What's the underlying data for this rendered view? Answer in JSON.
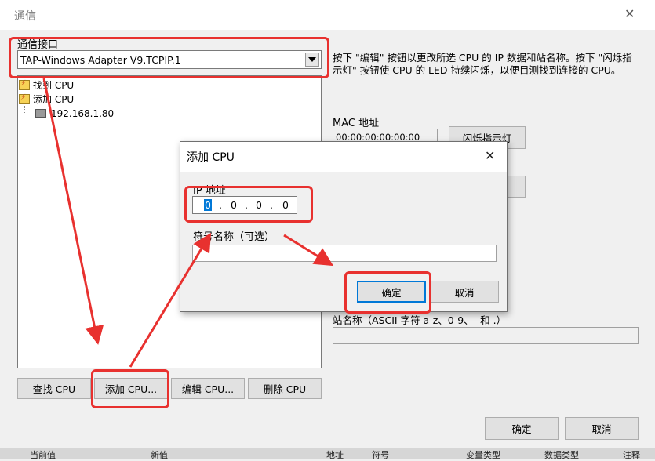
{
  "window": {
    "title": "通信",
    "close_glyph": "✕"
  },
  "comm_interface": {
    "label": "通信接口",
    "selected": "TAP-Windows Adapter V9.TCPIP.1"
  },
  "tree": {
    "items": [
      {
        "label": "找到 CPU"
      },
      {
        "label": "添加 CPU"
      },
      {
        "label": "192.168.1.80"
      }
    ]
  },
  "left_buttons": {
    "find": "查找 CPU",
    "add": "添加 CPU...",
    "edit": "编辑 CPU...",
    "delete": "删除 CPU"
  },
  "info_text": "按下 \"编辑\" 按钮以更改所选 CPU 的 IP 数据和站名称。按下 \"闪烁指示灯\" 按钮使 CPU 的 LED 持续闪烁，以便目测找到连接的 CPU。",
  "mac": {
    "label": "MAC 地址",
    "value": "00:00:00:00:00:00",
    "blink_button": "闪烁指示灯"
  },
  "station": {
    "label": "站名称（ASCII 字符 a-z、0-9、- 和 .）",
    "value": ""
  },
  "footer": {
    "ok": "确定",
    "cancel": "取消"
  },
  "bottom_strip": {
    "cols": [
      "当前值",
      "新值",
      "地址",
      "符号",
      "变量类型",
      "数据类型",
      "注释"
    ]
  },
  "dialog": {
    "title": "添加 CPU",
    "close_glyph": "✕",
    "ip_label": "IP 地址",
    "ip_octets": [
      "0",
      "0",
      "0",
      "0"
    ],
    "ip_sep": ".",
    "symbol_label": "符号名称（可选）",
    "symbol_value": "",
    "ok": "确定",
    "cancel": "取消"
  },
  "colors": {
    "annotation_red": "#e8312f",
    "selection_blue": "#0078d7"
  }
}
